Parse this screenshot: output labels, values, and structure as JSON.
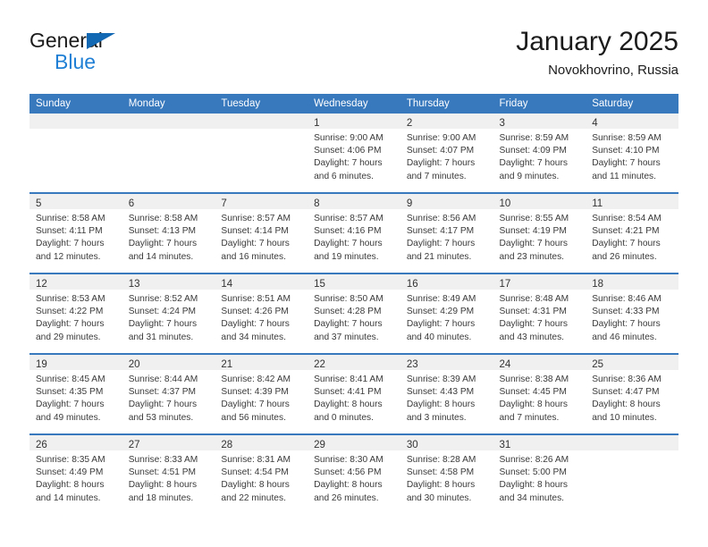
{
  "brand": {
    "word_one": "General",
    "word_two": "Blue",
    "triangle_color": "#1268b3",
    "blue_text_color": "#1e7fd4"
  },
  "header": {
    "title": "January 2025",
    "subtitle": "Novokhovrino, Russia",
    "header_bg_color": "#3878bd",
    "header_text_color": "#ffffff"
  },
  "weekday_headers": [
    "Sunday",
    "Monday",
    "Tuesday",
    "Wednesday",
    "Thursday",
    "Friday",
    "Saturday"
  ],
  "labels": {
    "sunrise_prefix": "Sunrise:",
    "sunset_prefix": "Sunset:",
    "daylight_prefix": "Daylight:"
  },
  "weeks": [
    [
      {
        "day": "",
        "lines": []
      },
      {
        "day": "",
        "lines": []
      },
      {
        "day": "",
        "lines": []
      },
      {
        "day": "1",
        "lines": [
          "Sunrise: 9:00 AM",
          "Sunset: 4:06 PM",
          "Daylight: 7 hours",
          "and 6 minutes."
        ]
      },
      {
        "day": "2",
        "lines": [
          "Sunrise: 9:00 AM",
          "Sunset: 4:07 PM",
          "Daylight: 7 hours",
          "and 7 minutes."
        ]
      },
      {
        "day": "3",
        "lines": [
          "Sunrise: 8:59 AM",
          "Sunset: 4:09 PM",
          "Daylight: 7 hours",
          "and 9 minutes."
        ]
      },
      {
        "day": "4",
        "lines": [
          "Sunrise: 8:59 AM",
          "Sunset: 4:10 PM",
          "Daylight: 7 hours",
          "and 11 minutes."
        ]
      }
    ],
    [
      {
        "day": "5",
        "lines": [
          "Sunrise: 8:58 AM",
          "Sunset: 4:11 PM",
          "Daylight: 7 hours",
          "and 12 minutes."
        ]
      },
      {
        "day": "6",
        "lines": [
          "Sunrise: 8:58 AM",
          "Sunset: 4:13 PM",
          "Daylight: 7 hours",
          "and 14 minutes."
        ]
      },
      {
        "day": "7",
        "lines": [
          "Sunrise: 8:57 AM",
          "Sunset: 4:14 PM",
          "Daylight: 7 hours",
          "and 16 minutes."
        ]
      },
      {
        "day": "8",
        "lines": [
          "Sunrise: 8:57 AM",
          "Sunset: 4:16 PM",
          "Daylight: 7 hours",
          "and 19 minutes."
        ]
      },
      {
        "day": "9",
        "lines": [
          "Sunrise: 8:56 AM",
          "Sunset: 4:17 PM",
          "Daylight: 7 hours",
          "and 21 minutes."
        ]
      },
      {
        "day": "10",
        "lines": [
          "Sunrise: 8:55 AM",
          "Sunset: 4:19 PM",
          "Daylight: 7 hours",
          "and 23 minutes."
        ]
      },
      {
        "day": "11",
        "lines": [
          "Sunrise: 8:54 AM",
          "Sunset: 4:21 PM",
          "Daylight: 7 hours",
          "and 26 minutes."
        ]
      }
    ],
    [
      {
        "day": "12",
        "lines": [
          "Sunrise: 8:53 AM",
          "Sunset: 4:22 PM",
          "Daylight: 7 hours",
          "and 29 minutes."
        ]
      },
      {
        "day": "13",
        "lines": [
          "Sunrise: 8:52 AM",
          "Sunset: 4:24 PM",
          "Daylight: 7 hours",
          "and 31 minutes."
        ]
      },
      {
        "day": "14",
        "lines": [
          "Sunrise: 8:51 AM",
          "Sunset: 4:26 PM",
          "Daylight: 7 hours",
          "and 34 minutes."
        ]
      },
      {
        "day": "15",
        "lines": [
          "Sunrise: 8:50 AM",
          "Sunset: 4:28 PM",
          "Daylight: 7 hours",
          "and 37 minutes."
        ]
      },
      {
        "day": "16",
        "lines": [
          "Sunrise: 8:49 AM",
          "Sunset: 4:29 PM",
          "Daylight: 7 hours",
          "and 40 minutes."
        ]
      },
      {
        "day": "17",
        "lines": [
          "Sunrise: 8:48 AM",
          "Sunset: 4:31 PM",
          "Daylight: 7 hours",
          "and 43 minutes."
        ]
      },
      {
        "day": "18",
        "lines": [
          "Sunrise: 8:46 AM",
          "Sunset: 4:33 PM",
          "Daylight: 7 hours",
          "and 46 minutes."
        ]
      }
    ],
    [
      {
        "day": "19",
        "lines": [
          "Sunrise: 8:45 AM",
          "Sunset: 4:35 PM",
          "Daylight: 7 hours",
          "and 49 minutes."
        ]
      },
      {
        "day": "20",
        "lines": [
          "Sunrise: 8:44 AM",
          "Sunset: 4:37 PM",
          "Daylight: 7 hours",
          "and 53 minutes."
        ]
      },
      {
        "day": "21",
        "lines": [
          "Sunrise: 8:42 AM",
          "Sunset: 4:39 PM",
          "Daylight: 7 hours",
          "and 56 minutes."
        ]
      },
      {
        "day": "22",
        "lines": [
          "Sunrise: 8:41 AM",
          "Sunset: 4:41 PM",
          "Daylight: 8 hours",
          "and 0 minutes."
        ]
      },
      {
        "day": "23",
        "lines": [
          "Sunrise: 8:39 AM",
          "Sunset: 4:43 PM",
          "Daylight: 8 hours",
          "and 3 minutes."
        ]
      },
      {
        "day": "24",
        "lines": [
          "Sunrise: 8:38 AM",
          "Sunset: 4:45 PM",
          "Daylight: 8 hours",
          "and 7 minutes."
        ]
      },
      {
        "day": "25",
        "lines": [
          "Sunrise: 8:36 AM",
          "Sunset: 4:47 PM",
          "Daylight: 8 hours",
          "and 10 minutes."
        ]
      }
    ],
    [
      {
        "day": "26",
        "lines": [
          "Sunrise: 8:35 AM",
          "Sunset: 4:49 PM",
          "Daylight: 8 hours",
          "and 14 minutes."
        ]
      },
      {
        "day": "27",
        "lines": [
          "Sunrise: 8:33 AM",
          "Sunset: 4:51 PM",
          "Daylight: 8 hours",
          "and 18 minutes."
        ]
      },
      {
        "day": "28",
        "lines": [
          "Sunrise: 8:31 AM",
          "Sunset: 4:54 PM",
          "Daylight: 8 hours",
          "and 22 minutes."
        ]
      },
      {
        "day": "29",
        "lines": [
          "Sunrise: 8:30 AM",
          "Sunset: 4:56 PM",
          "Daylight: 8 hours",
          "and 26 minutes."
        ]
      },
      {
        "day": "30",
        "lines": [
          "Sunrise: 8:28 AM",
          "Sunset: 4:58 PM",
          "Daylight: 8 hours",
          "and 30 minutes."
        ]
      },
      {
        "day": "31",
        "lines": [
          "Sunrise: 8:26 AM",
          "Sunset: 5:00 PM",
          "Daylight: 8 hours",
          "and 34 minutes."
        ]
      },
      {
        "day": "",
        "lines": []
      }
    ]
  ]
}
